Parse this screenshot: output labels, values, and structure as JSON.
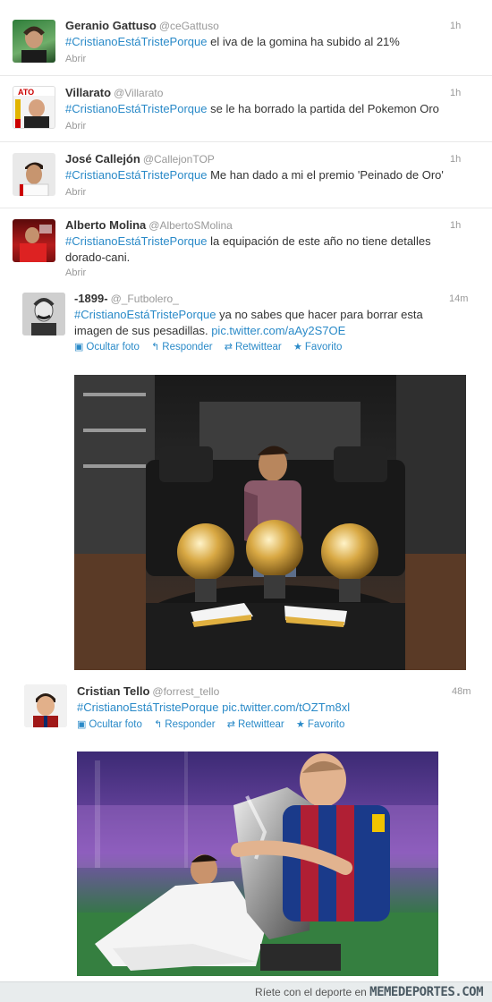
{
  "tweets": [
    {
      "name": "Geranio Gattuso",
      "handle": "@ceGattuso",
      "time": "1h",
      "hashtag": "#CristianoEstáTristePorque",
      "text": " el iva de la gomina ha subido al 21%",
      "expand": "Abrir"
    },
    {
      "name": "Villarato",
      "handle": "@Villarato",
      "time": "1h",
      "hashtag": "#CristianoEstáTristePorque",
      "text": " se le ha borrado la partida del Pokemon Oro",
      "expand": "Abrir"
    },
    {
      "name": "José Callejón",
      "handle": "@CallejonTOP",
      "time": "1h",
      "hashtag": "#CristianoEstáTristePorque",
      "text": " Me han dado a mi el premio 'Peinado de Oro'",
      "expand": "Abrir"
    },
    {
      "name": "Alberto Molina",
      "handle": "@AlbertoSMolina",
      "time": "1h",
      "hashtag": "#CristianoEstáTristePorque",
      "text": " la equipación de este año no tiene detalles",
      "text2": "dorado-cani.",
      "expand": "Abrir"
    },
    {
      "name": "-1899-",
      "handle": "@_Futbolero_",
      "time": "14m",
      "hashtag": "#CristianoEstáTristePorque",
      "text": " ya no sabes que hacer para borrar esta",
      "text2": "imagen de sus pesadillas. ",
      "link": "pic.twitter.com/aAy2S7OE",
      "actions": [
        "Ocultar foto",
        "Responder",
        "Retwittear",
        "Favorito"
      ]
    },
    {
      "name": "Cristian Tello",
      "handle": "@forrest_tello",
      "time": "48m",
      "hashtag": "#CristianoEstáTristePorque",
      "link": " pic.twitter.com/tOZTm8xl",
      "actions": [
        "Ocultar foto",
        "Responder",
        "Retwittear",
        "Favorito"
      ]
    }
  ],
  "footer": {
    "prefix": "Ríete con el deporte en ",
    "brand": "MEMEDEPORTES.COM"
  },
  "colors": {
    "link": "#2a8ac8",
    "muted": "#999999",
    "text": "#333333"
  },
  "icons": [
    "photo-icon",
    "reply-icon",
    "retweet-icon",
    "star-icon"
  ]
}
